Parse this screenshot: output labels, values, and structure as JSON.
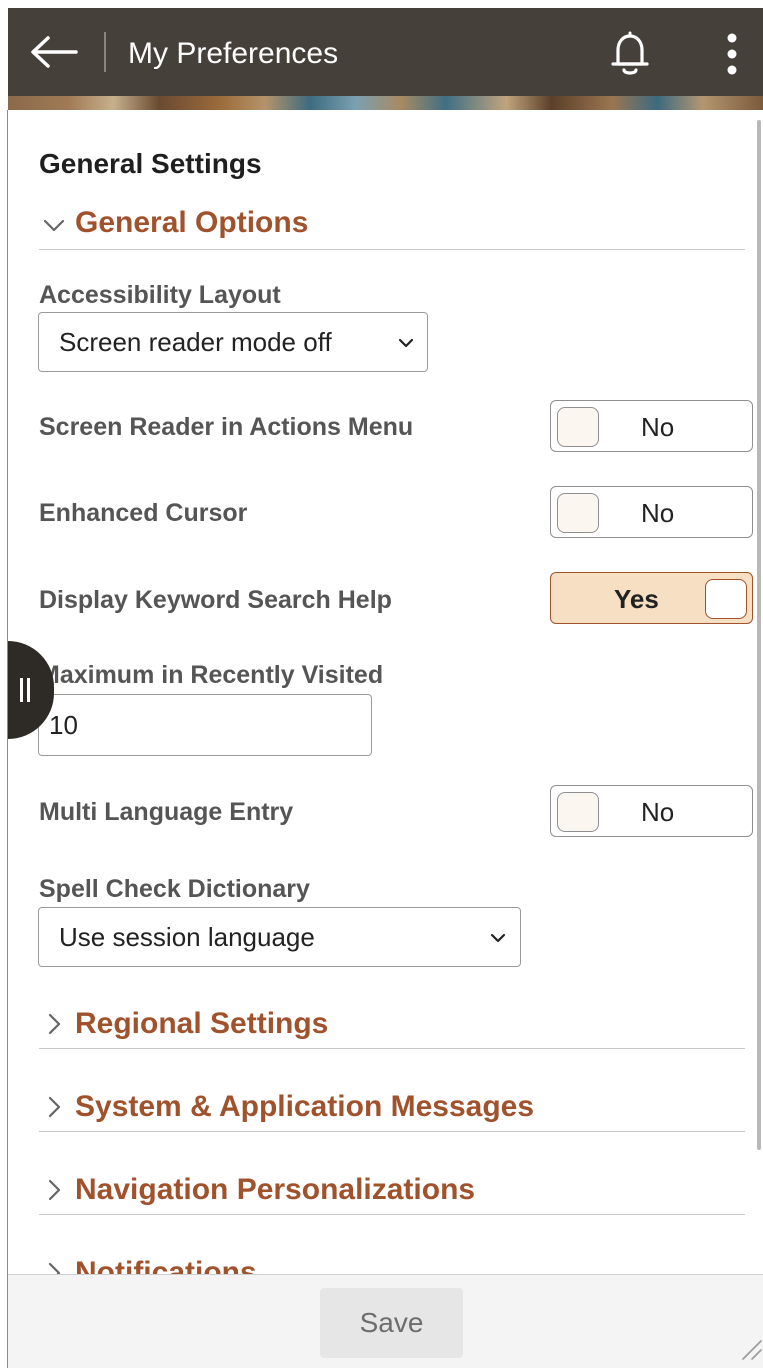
{
  "header": {
    "title": "My Preferences",
    "icons": {
      "back": "back-arrow-icon",
      "notifications": "bell-icon",
      "more": "more-vertical-icon"
    }
  },
  "general_settings": {
    "title": "General Settings",
    "general_options": {
      "label": "General Options",
      "expanded": true,
      "accessibility_layout": {
        "label": "Accessibility Layout",
        "value": "Screen reader mode off"
      },
      "screen_reader_actions_menu": {
        "label": "Screen Reader in Actions Menu",
        "value": "No"
      },
      "enhanced_cursor": {
        "label": "Enhanced Cursor",
        "value": "No"
      },
      "keyword_search_help": {
        "label": "Display Keyword Search Help",
        "value": "Yes"
      },
      "max_recently_visited": {
        "label": "Maximum in Recently Visited",
        "value": "10"
      },
      "multi_language_entry": {
        "label": "Multi Language Entry",
        "value": "No"
      },
      "spell_check_dictionary": {
        "label": "Spell Check Dictionary",
        "value": "Use session language"
      }
    },
    "collapsed_groups": [
      {
        "label": "Regional Settings"
      },
      {
        "label": "System & Application Messages"
      },
      {
        "label": "Navigation Personalizations"
      },
      {
        "label": "Notifications"
      }
    ]
  },
  "footer": {
    "save_label": "Save"
  },
  "colors": {
    "header_bg": "#46403a",
    "accent": "#a0522d",
    "toggle_on_bg": "#f7dfc4",
    "label_text": "#555555"
  }
}
